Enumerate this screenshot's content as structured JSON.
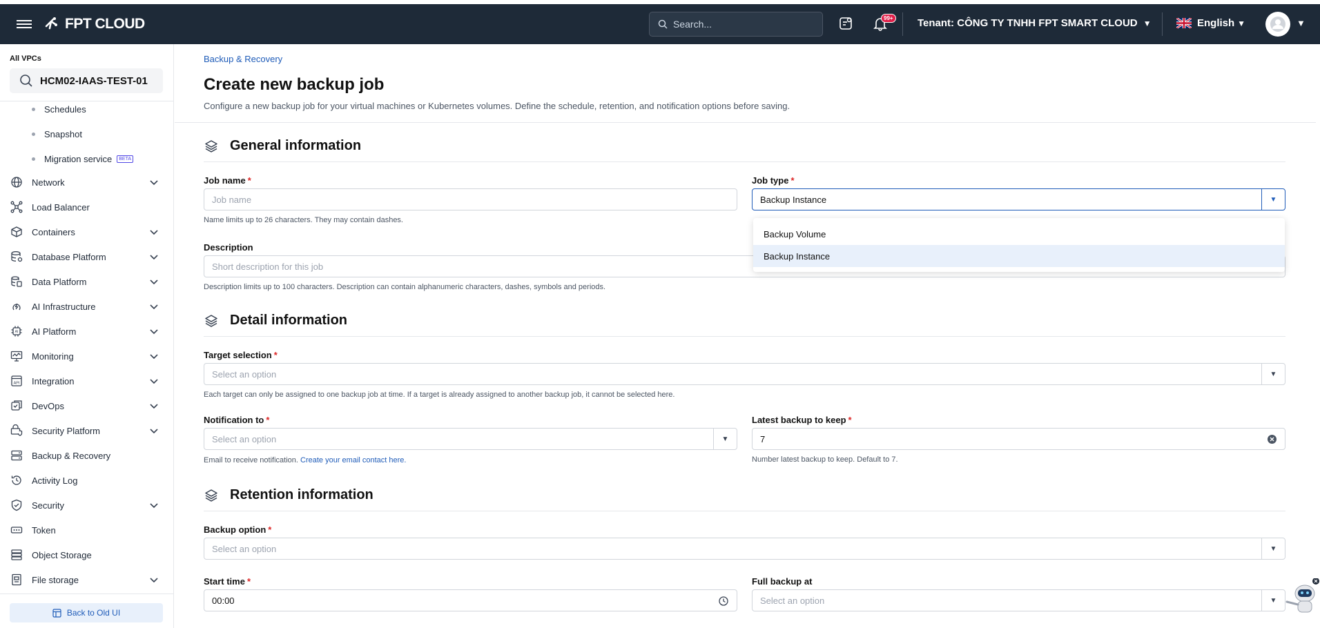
{
  "topbar": {
    "logo_text": "FPT CLOUD",
    "search_placeholder": "Search...",
    "notif_badge": "99+",
    "tenant_label": "Tenant:",
    "tenant_name": "CÔNG TY TNHH FPT SMART CLOUD",
    "language": "English"
  },
  "sidebar": {
    "vpc_header": "All VPCs",
    "vpc_selected": "HCM02-IAAS-TEST-01",
    "subitems": [
      {
        "label": "Schedules"
      },
      {
        "label": "Snapshot"
      },
      {
        "label": "Migration service",
        "badge": "BETA"
      }
    ],
    "items": [
      {
        "label": "Network",
        "icon": "globe-icon",
        "expandable": true
      },
      {
        "label": "Load Balancer",
        "icon": "load-balancer-icon",
        "expandable": false
      },
      {
        "label": "Containers",
        "icon": "cube-icon",
        "expandable": true
      },
      {
        "label": "Database Platform",
        "icon": "database-icon",
        "expandable": true
      },
      {
        "label": "Data Platform",
        "icon": "data-platform-icon",
        "expandable": true
      },
      {
        "label": "AI Infrastructure",
        "icon": "ai-infrastructure-icon",
        "expandable": true
      },
      {
        "label": "AI Platform",
        "icon": "chip-icon",
        "expandable": true
      },
      {
        "label": "Monitoring",
        "icon": "monitor-icon",
        "expandable": true
      },
      {
        "label": "Integration",
        "icon": "api-icon",
        "expandable": true
      },
      {
        "label": "DevOps",
        "icon": "devops-icon",
        "expandable": true
      },
      {
        "label": "Security Platform",
        "icon": "security-platform-icon",
        "expandable": true
      },
      {
        "label": "Backup & Recovery",
        "icon": "backup-icon",
        "expandable": false
      },
      {
        "label": "Activity Log",
        "icon": "clock-icon",
        "expandable": false
      },
      {
        "label": "Security",
        "icon": "shield-icon",
        "expandable": true
      },
      {
        "label": "Token",
        "icon": "token-icon",
        "expandable": false
      },
      {
        "label": "Object Storage",
        "icon": "storage-icon",
        "expandable": false
      },
      {
        "label": "File storage",
        "icon": "file-storage-icon",
        "expandable": true
      }
    ],
    "back_old_ui": "Back to Old UI"
  },
  "page": {
    "breadcrumb": "Backup & Recovery",
    "title": "Create new backup job",
    "description": "Configure a new backup job for your virtual machines or Kubernetes volumes. Define the schedule, retention, and notification options before saving."
  },
  "general": {
    "heading": "General information",
    "job_name_label": "Job name",
    "job_name_placeholder": "Job name",
    "job_name_help": "Name limits up to 26 characters. They may contain dashes.",
    "job_type_label": "Job type",
    "job_type_value": "Backup Instance",
    "job_type_options": [
      "Backup Volume",
      "Backup Instance"
    ],
    "description_label": "Description",
    "description_placeholder": "Short description for this job",
    "description_help": "Description limits up to 100 characters. Description can contain alphanumeric characters, dashes, symbols and periods."
  },
  "detail": {
    "heading": "Detail information",
    "target_label": "Target selection",
    "target_placeholder": "Select an option",
    "target_help": "Each target can only be assigned to one backup job at time. If a target is already assigned to another backup job, it cannot be selected here.",
    "notification_label": "Notification to",
    "notification_placeholder": "Select an option",
    "notification_help": "Email to receive notification.",
    "notification_link": "Create your email contact here.",
    "latest_label": "Latest backup to keep",
    "latest_value": "7",
    "latest_help": "Number latest backup to keep. Default to 7."
  },
  "retention": {
    "heading": "Retention information",
    "backup_option_label": "Backup option",
    "backup_option_placeholder": "Select an option",
    "start_time_label": "Start time",
    "start_time_value": "00:00",
    "full_backup_label": "Full backup at",
    "full_backup_placeholder": "Select an option"
  },
  "colors": {
    "topbar_bg": "#1e2a38",
    "accent": "#1e5bb8",
    "required": "#dc2626"
  }
}
